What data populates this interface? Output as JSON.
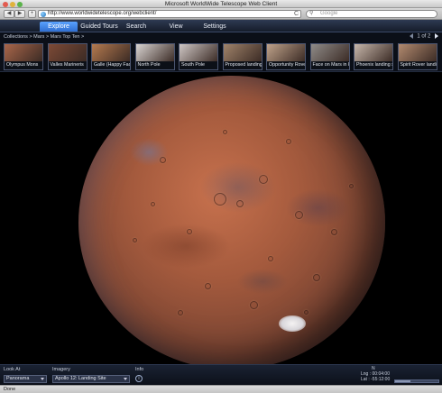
{
  "window": {
    "title": "Microsoft WorldWide Telescope Web Client"
  },
  "browser": {
    "back_label": "◀",
    "forward_label": "▶",
    "add_label": "+",
    "url": "http://www.worldwidetelescope.org/webclient/",
    "reload_label": "C",
    "search_placeholder": "Google",
    "status": "Done"
  },
  "nav": {
    "tabs": [
      {
        "label": "Explore",
        "active": true
      },
      {
        "label": "Guided Tours"
      },
      {
        "label": "Search"
      },
      {
        "label": "View"
      },
      {
        "label": "Settings"
      }
    ]
  },
  "breadcrumb": {
    "text": "Collections  >  Mars  >  Mars Top Ten  >"
  },
  "pager": {
    "text": "1 of 2"
  },
  "thumbnails": [
    {
      "label": "Olympus Mons",
      "color": "#a9664a"
    },
    {
      "label": "Valles Marineris",
      "color": "#7d4a36"
    },
    {
      "label": "Galle (Happy Face",
      "color": "#b57a4f"
    },
    {
      "label": "North Pole",
      "color": "#d9d4d2"
    },
    {
      "label": "South Pole",
      "color": "#cfc7c5"
    },
    {
      "label": "Proposed landing s",
      "color": "#a0836a"
    },
    {
      "label": "Opportunity Rover",
      "color": "#bfa28a"
    },
    {
      "label": "Face on Mars in Hi",
      "color": "#8f8b88"
    },
    {
      "label": "Phoenix landing sit",
      "color": "#c7b7ab"
    },
    {
      "label": "Spirit Rover landin",
      "color": "#b28a6f"
    }
  ],
  "bottom": {
    "look_at_label": "Look At",
    "look_at_value": "Panorama",
    "imagery_label": "Imagery",
    "imagery_value": "Apollo 12: Landing Site",
    "info_label": "Info",
    "info_icon": "i",
    "coords_n": "N",
    "coords_lng": "Lng : 00:04:00",
    "coords_lat": "Lat : -55:12:00",
    "zoom_fraction": 0.35
  },
  "colors": {
    "accent": "#2f6fd1",
    "nav_bg": "#151c2a"
  }
}
